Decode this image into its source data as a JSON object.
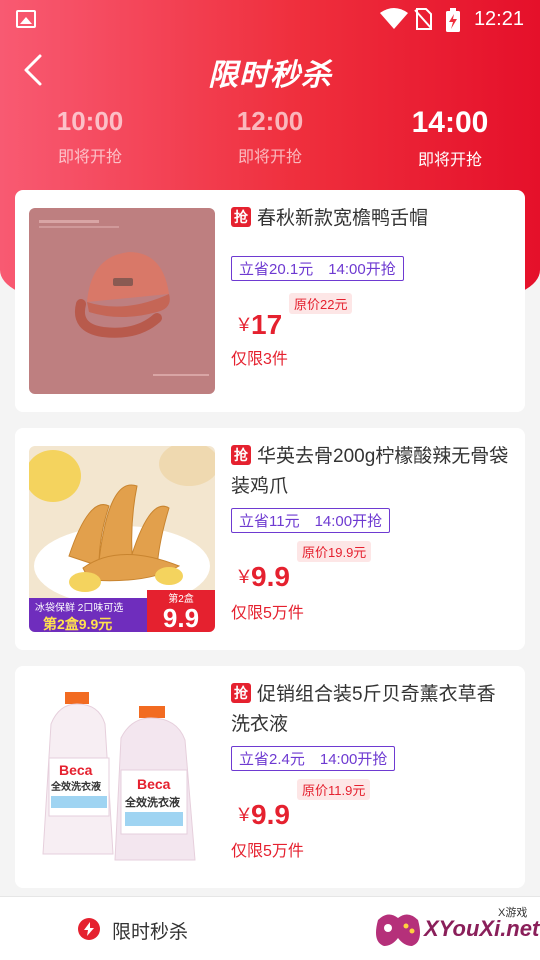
{
  "status_bar": {
    "time": "12:21"
  },
  "header": {
    "title": "限时秒杀"
  },
  "tabs": [
    {
      "time": "10:00",
      "status": "即将开抢",
      "active": false
    },
    {
      "time": "12:00",
      "status": "即将开抢",
      "active": false
    },
    {
      "time": "14:00",
      "status": "即将开抢",
      "active": true
    }
  ],
  "products": [
    {
      "badge": "抢",
      "name": "春秋新款宽檐鸭舌帽",
      "save_tag": "立省20.1元　14:00开抢",
      "currency": "￥",
      "price": "17",
      "original_price": "原价22元",
      "limit": "仅限3件",
      "image": "pink-baseball-cap"
    },
    {
      "badge": "抢",
      "name": "华英去骨200g柠檬酸辣无骨袋装鸡爪",
      "save_tag": "立省11元　14:00开抢",
      "currency": "￥",
      "price": "9.9",
      "original_price": "原价19.9元",
      "limit": "仅限5万件",
      "image": "lemon-chicken-feet",
      "promo": {
        "left": "冰袋保鲜 2口味可选",
        "left2": "第2盒9.9元",
        "right_small": "第2盒",
        "right_big": "9.9"
      }
    },
    {
      "badge": "抢",
      "name": "促销组合装5斤贝奇薰衣草香洗衣液",
      "save_tag": "立省2.4元　14:00开抢",
      "currency": "￥",
      "price": "9.9",
      "original_price": "原价11.9元",
      "limit": "仅限5万件",
      "image": "laundry-detergent-bottles",
      "bottle": {
        "brand": "Beca",
        "label": "全效洗衣液"
      }
    }
  ],
  "bottom_nav": {
    "label": "限时秒杀"
  },
  "watermark": {
    "text": "XYouXi.net",
    "small": "X游戏"
  },
  "colors": {
    "accent": "#e5212f",
    "tag_purple": "#6e3ad1"
  }
}
